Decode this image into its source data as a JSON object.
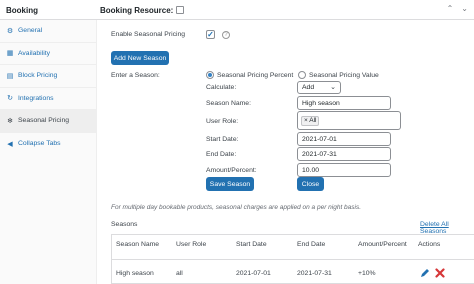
{
  "topbar": {
    "title": "Booking",
    "resource_label": "Booking Resource:"
  },
  "sidebar": {
    "items": [
      {
        "label": "General",
        "icon": "gear-icon",
        "glyph": "⚙"
      },
      {
        "label": "Availability",
        "icon": "calendar-icon",
        "glyph": "▦"
      },
      {
        "label": "Block Pricing",
        "icon": "block-icon",
        "glyph": "▤"
      },
      {
        "label": "Integrations",
        "icon": "refresh-icon",
        "glyph": "↻"
      },
      {
        "label": "Seasonal Pricing",
        "icon": "snowflake-icon",
        "glyph": "❄"
      }
    ],
    "collapse_label": "Collapse Tabs"
  },
  "form": {
    "enable_label": "Enable Seasonal Pricing",
    "help_glyph": "?",
    "add_button": "Add New Season",
    "enter_season_label": "Enter a Season:",
    "radio_percent": "Seasonal Pricing Percent",
    "radio_value": "Seasonal Pricing Value",
    "calculate_label": "Calculate:",
    "calculate_value": "Add",
    "season_name_label": "Season Name:",
    "season_name_value": "High season",
    "user_role_label": "User Role:",
    "user_role_tag": "× All",
    "start_date_label": "Start Date:",
    "start_date_value": "2021-07-01",
    "end_date_label": "End Date:",
    "end_date_value": "2021-07-31",
    "amount_label": "Amount/Percent:",
    "amount_value": "10.00",
    "save_button": "Save Season",
    "close_button": "Close",
    "note": "For multiple day bookable products, seasonal charges are applied on a per night basis."
  },
  "seasons": {
    "heading": "Seasons",
    "delete_all": "Delete All Seasons",
    "columns": [
      "Season Name",
      "User Role",
      "Start Date",
      "End Date",
      "Amount/Percent",
      "Actions"
    ],
    "row": {
      "name": "High season",
      "role": "all",
      "start": "2021-07-01",
      "end": "2021-07-31",
      "amount": "+10%"
    }
  },
  "colors": {
    "accent": "#2271b1",
    "delete": "#d63638"
  }
}
